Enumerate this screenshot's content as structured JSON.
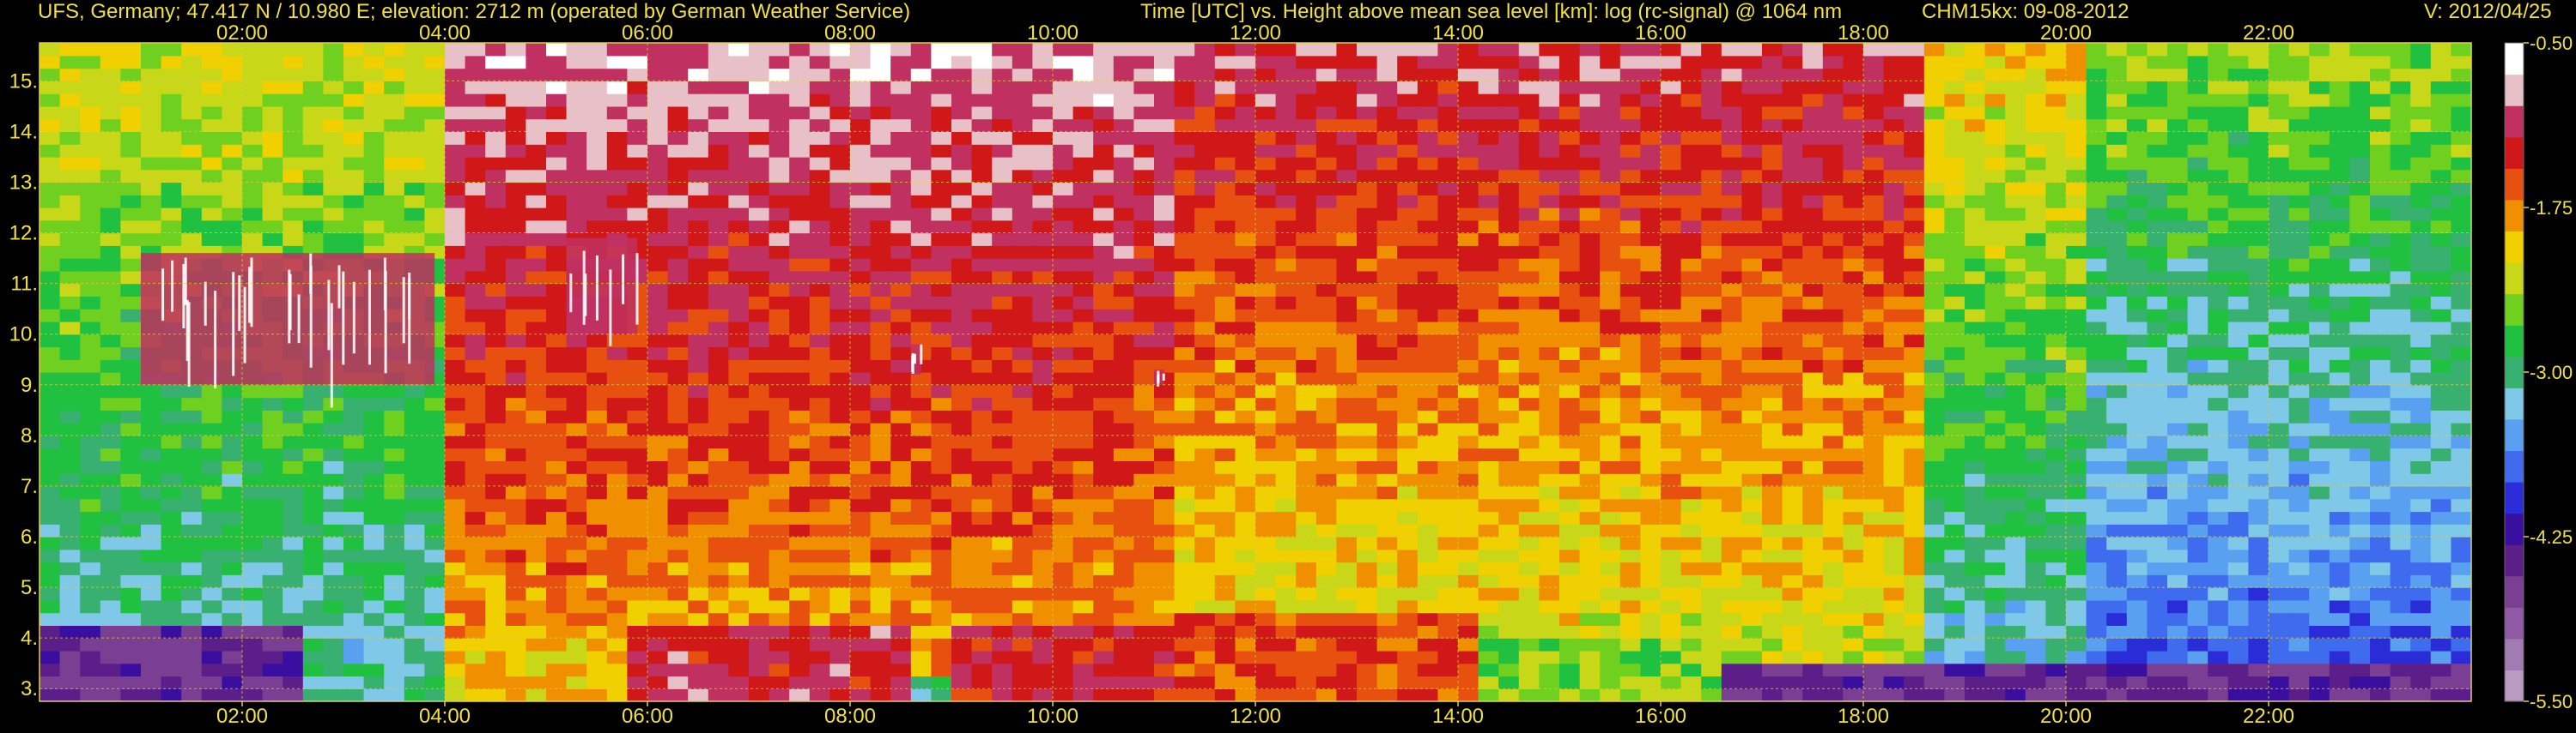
{
  "header": {
    "station": "UFS, Germany; 47.417 N / 10.980 E; elevation: 2712 m  (operated by German Weather Service)",
    "axes_title": "Time [UTC] vs. Height above mean sea level [km]: log (rc-signal) @ 1064 nm",
    "instrument_date": "CHM15kx: 09-08-2012",
    "version": "V: 2012/04/25"
  },
  "chart_data": {
    "type": "heatmap",
    "title": "Time [UTC] vs. Height above mean sea level [km]: log (rc-signal) @ 1064 nm",
    "xlabel": "",
    "ylabel": "",
    "x_unit": "hours UTC",
    "xlim": [
      0,
      24
    ],
    "ylim": [
      2.75,
      15.75
    ],
    "x_ticks": [
      2,
      4,
      6,
      8,
      10,
      12,
      14,
      16,
      18,
      20,
      22
    ],
    "x_tick_labels": [
      "02:00",
      "04:00",
      "06:00",
      "08:00",
      "10:00",
      "12:00",
      "14:00",
      "16:00",
      "18:00",
      "20:00",
      "22:00"
    ],
    "y_ticks": [
      3,
      4,
      5,
      6,
      7,
      8,
      9,
      10,
      11,
      12,
      13,
      14,
      15
    ],
    "y_tick_labels": [
      "3.",
      "4.",
      "5.",
      "6.",
      "7.",
      "8.",
      "9.",
      "10.",
      "11.",
      "12.",
      "13.",
      "14.",
      "15."
    ],
    "grid": true,
    "colorbar": {
      "range": [
        -5.5,
        -0.5
      ],
      "ticks": [
        -0.5,
        -1.75,
        -3.0,
        -4.25,
        -5.5
      ],
      "tick_labels": [
        "-0.50",
        "-1.75",
        "-3.00",
        "-4.25",
        "-5.50"
      ],
      "colors": [
        "#b99ac0",
        "#a27bb2",
        "#8f5aa3",
        "#7a3f93",
        "#5c1f8a",
        "#3a0fa0",
        "#2a2cd8",
        "#3f6bee",
        "#5aa0f0",
        "#7fc8e8",
        "#38b070",
        "#20c040",
        "#70d020",
        "#c8d818",
        "#f0d000",
        "#f09000",
        "#e85010",
        "#d01818",
        "#c03060",
        "#e8c0c8",
        "#ffffff"
      ]
    },
    "cloud_layers": [
      {
        "t_start": 1.0,
        "t_end": 3.9,
        "h_bottom": 9.0,
        "h_top": 11.6,
        "intensity": -1.0
      },
      {
        "t_start": 5.2,
        "t_end": 5.9,
        "h_bottom": 10.0,
        "h_top": 11.9,
        "intensity": -1.0
      },
      {
        "t_start": 8.6,
        "t_end": 8.7,
        "h_bottom": 9.2,
        "h_top": 9.8,
        "intensity": -1.2
      },
      {
        "t_start": 11.0,
        "t_end": 11.1,
        "h_bottom": 9.0,
        "h_top": 9.3,
        "intensity": -1.2
      }
    ],
    "boundary_layer": [
      {
        "t_start": 0.0,
        "t_end": 2.5,
        "top": 4.2,
        "intensity": -4.5
      },
      {
        "t_start": 2.5,
        "t_end": 4.0,
        "top": 3.6,
        "intensity": -3.0
      },
      {
        "t_start": 4.0,
        "t_end": 5.8,
        "top": 4.0,
        "intensity": -2.0
      },
      {
        "t_start": 5.8,
        "t_end": 8.5,
        "top": 4.3,
        "intensity": -1.2
      },
      {
        "t_start": 8.5,
        "t_end": 9.0,
        "top": 3.3,
        "intensity": -3.0
      },
      {
        "t_start": 9.0,
        "t_end": 11.0,
        "top": 4.2,
        "intensity": -1.3
      },
      {
        "t_start": 11.0,
        "t_end": 14.0,
        "top": 4.4,
        "intensity": -1.5
      },
      {
        "t_start": 14.0,
        "t_end": 16.5,
        "top": 4.0,
        "intensity": -2.5
      },
      {
        "t_start": 16.5,
        "t_end": 24.0,
        "top": 3.6,
        "intensity": -4.5
      }
    ],
    "background_profile": [
      {
        "t_start": 0.0,
        "t_end": 4.0,
        "high_intensity": -2.2,
        "low_intensity": -3.2
      },
      {
        "t_start": 4.0,
        "t_end": 11.0,
        "high_intensity": -0.9,
        "low_intensity": -1.9
      },
      {
        "t_start": 11.0,
        "t_end": 18.5,
        "high_intensity": -1.1,
        "low_intensity": -2.3
      },
      {
        "t_start": 18.5,
        "t_end": 20.0,
        "high_intensity": -2.0,
        "low_intensity": -3.3
      },
      {
        "t_start": 20.0,
        "t_end": 24.0,
        "high_intensity": -2.4,
        "low_intensity": -3.8
      }
    ]
  }
}
